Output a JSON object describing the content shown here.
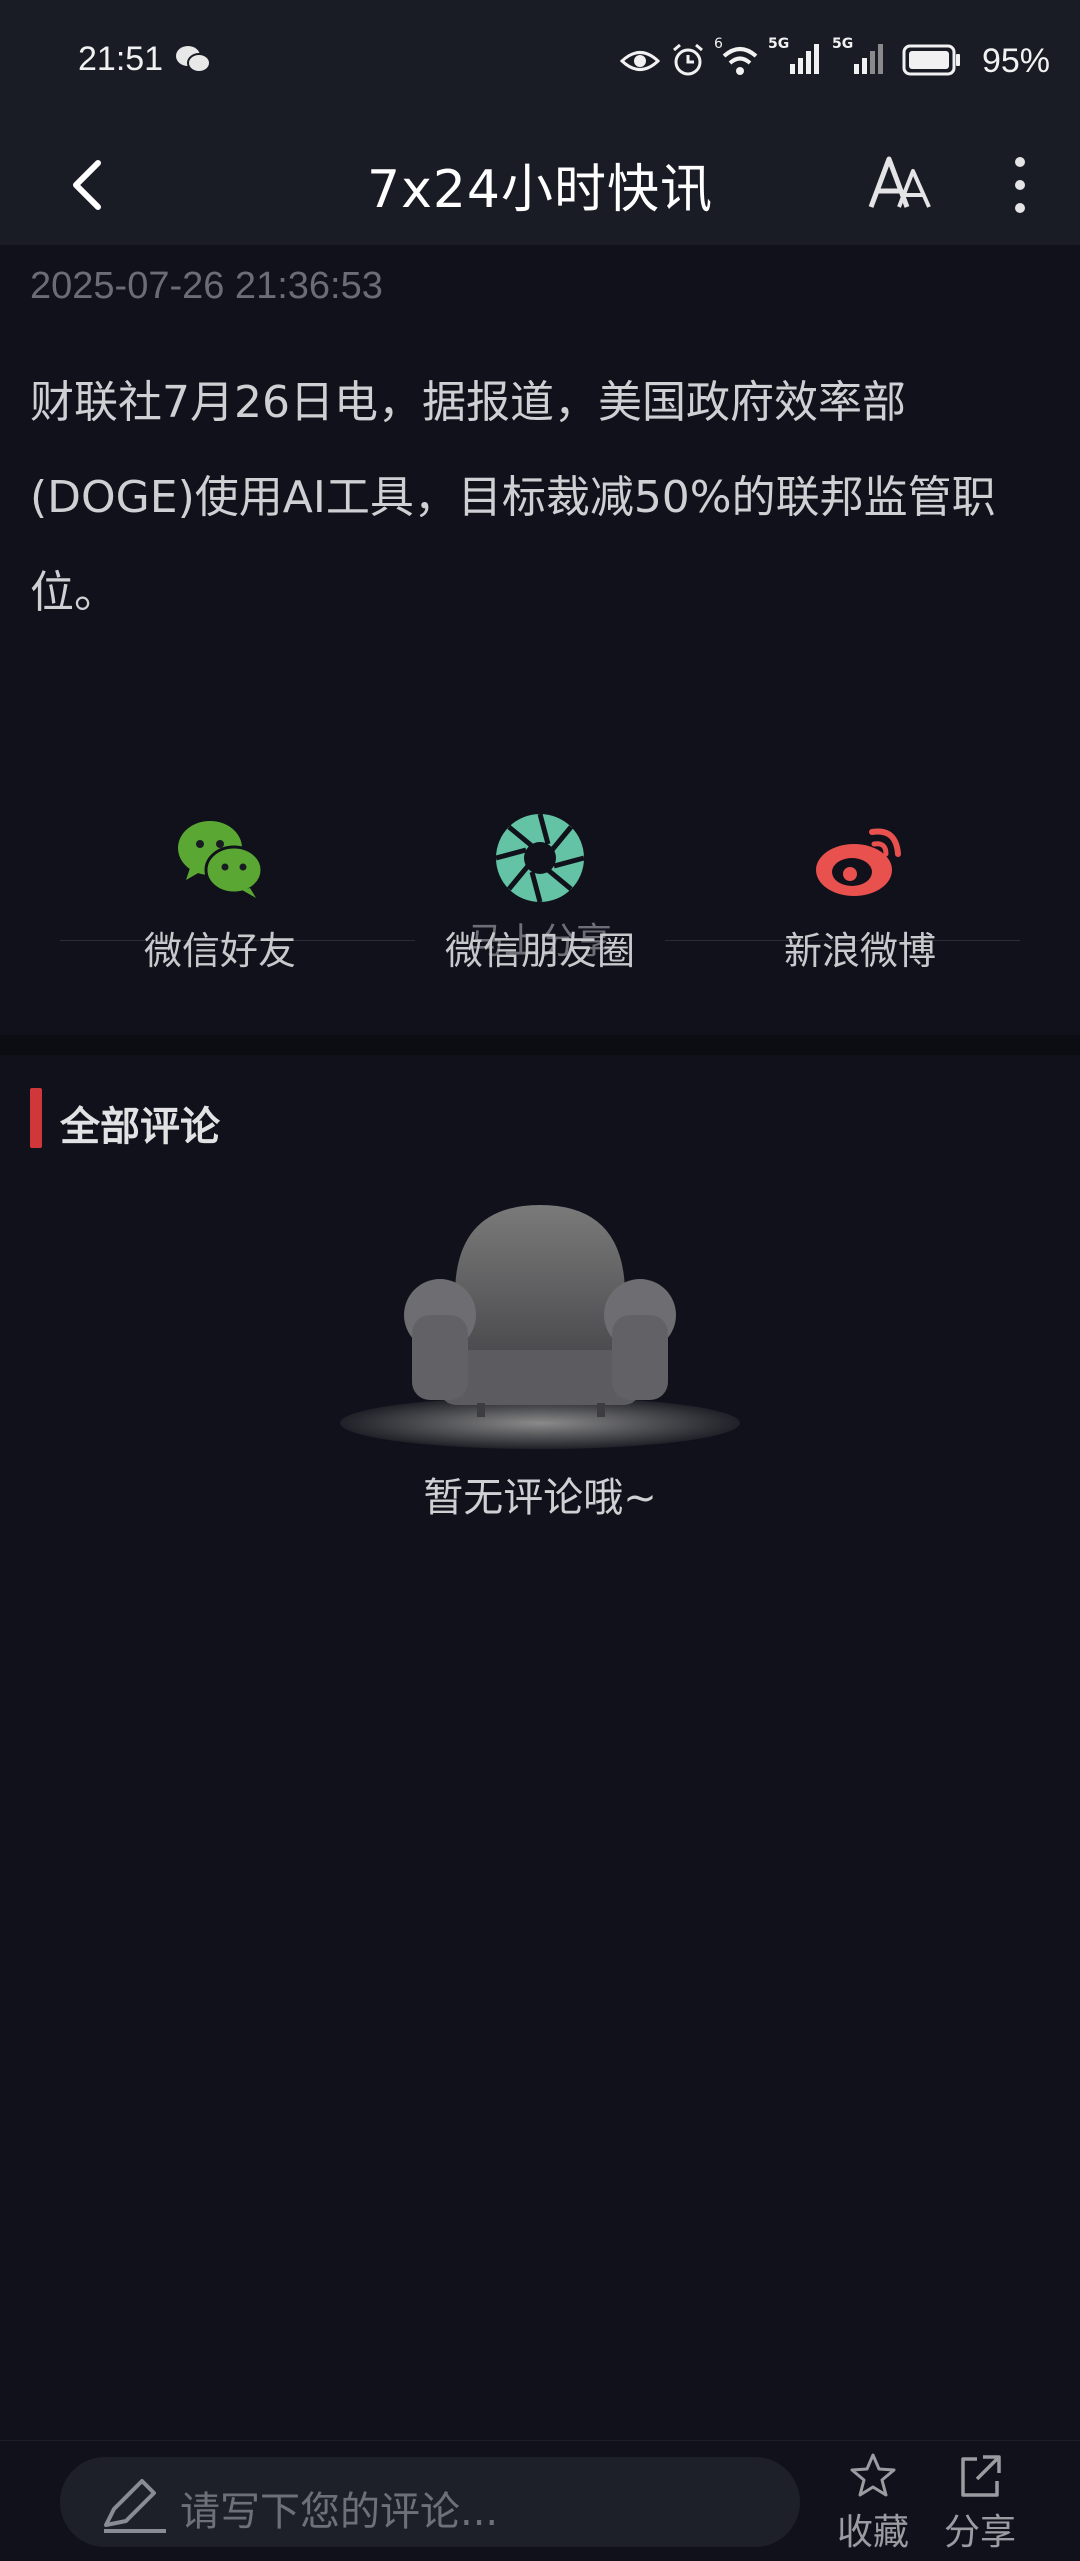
{
  "status_bar": {
    "time": "21:51",
    "network_labels": [
      "6",
      "5G",
      "5G"
    ],
    "battery": "95%"
  },
  "header": {
    "title": "7x24小时快讯"
  },
  "article": {
    "timestamp": "2025-07-26 21:36:53",
    "content": "财联社7月26日电，据报道，美国政府效率部(DOGE)使用AI工具，目标裁减50%的联邦监管职位。"
  },
  "share": {
    "title": "马上分享",
    "items": [
      {
        "label": "微信好友",
        "icon": "wechat-icon",
        "color": "#5aa833"
      },
      {
        "label": "微信朋友圈",
        "icon": "moments-icon",
        "color": "#63c3a4"
      },
      {
        "label": "新浪微博",
        "icon": "weibo-icon",
        "color": "#e9514f"
      }
    ]
  },
  "comments": {
    "title": "全部评论",
    "empty_text": "暂无评论哦~"
  },
  "bottom_bar": {
    "comment_placeholder": "请写下您的评论...",
    "favorite_label": "收藏",
    "share_label": "分享"
  },
  "colors": {
    "background": "#10111a",
    "header": "#191b25",
    "accent": "#d0373b"
  }
}
